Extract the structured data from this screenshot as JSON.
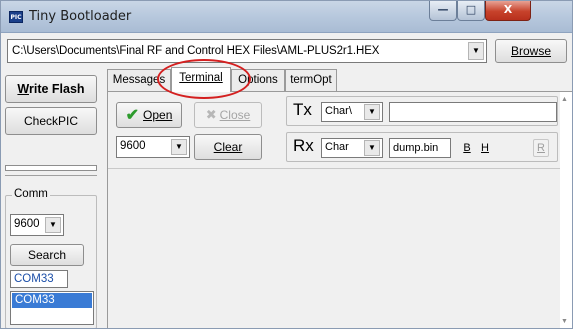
{
  "window": {
    "title": "Tiny Bootloader",
    "app_icon_text": "PIC",
    "minimize_glyph": "—",
    "maximize_glyph": "□",
    "close_glyph": "X"
  },
  "file": {
    "path": "C:\\Users\\Documents\\Final RF and Control HEX Files\\AML-PLUS2r1.HEX",
    "dropdown_glyph": "▼",
    "browse_label": "Browse"
  },
  "left_panel": {
    "write_flash_initial": "W",
    "write_flash_rest": "rite Flash",
    "checkpic_label": "CheckPIC",
    "comm_label": "Comm",
    "baud_value": "9600",
    "search_label": "Search",
    "port_value": "COM33",
    "port_list": [
      "COM33"
    ]
  },
  "tabs": [
    {
      "label": "Messages",
      "selected": false
    },
    {
      "label": "Terminal",
      "selected": true
    },
    {
      "label": "Options",
      "selected": false
    },
    {
      "label": "termOpt",
      "selected": false
    }
  ],
  "terminal": {
    "open_label": "Open",
    "close_label": "Close",
    "baud_value": "9600",
    "clear_label": "Clear",
    "tx_label": "Tx",
    "tx_mode": "Char\\",
    "tx_value": "",
    "rx_label": "Rx",
    "rx_mode": "Char",
    "rx_file": "dump.bin",
    "b_label": "B",
    "h_label": "H",
    "r_label": "R",
    "check_glyph": "✔",
    "x_glyph": "✖",
    "scroll_up_glyph": "▲",
    "scroll_down_glyph": "▼"
  }
}
